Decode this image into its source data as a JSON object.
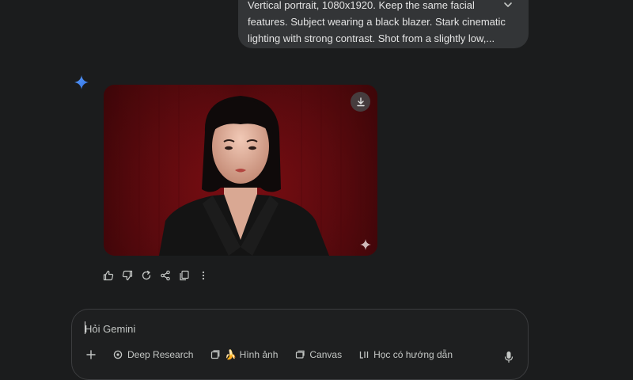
{
  "user_prompt": {
    "lines": [
      "Vertical portrait, 1080x1920. Keep the same facial",
      "features. Subject wearing a black blazer. Stark cinematic",
      "lighting with strong contrast. Shot from a slightly low,..."
    ],
    "expand_icon": "chevron-down-icon"
  },
  "response": {
    "logo_icon": "gemini-spark-icon",
    "image": {
      "description_icon": "generated-portrait-image",
      "download_icon": "download-icon",
      "watermark_icon": "sparkle-watermark-icon",
      "background_color": "#6b0b10"
    },
    "actions": [
      {
        "name": "thumbs-up-icon"
      },
      {
        "name": "thumbs-down-icon"
      },
      {
        "name": "regenerate-icon"
      },
      {
        "name": "share-icon"
      },
      {
        "name": "copy-icon"
      },
      {
        "name": "more-options-icon"
      }
    ]
  },
  "composer": {
    "placeholder": "Hỏi Gemini",
    "tools": [
      {
        "label": "",
        "icon": "plus-icon"
      },
      {
        "label": "Deep Research",
        "icon": "deep-research-icon"
      },
      {
        "label": "🍌 Hình ảnh",
        "icon": "image-icon"
      },
      {
        "label": "Canvas",
        "icon": "canvas-icon"
      },
      {
        "label": "Học có hướng dẫn",
        "icon": "guided-learning-icon"
      }
    ],
    "mic_icon": "microphone-icon"
  },
  "colors": {
    "background": "#1b1c1d",
    "bubble": "#333537",
    "text": "#e3e3e3",
    "gemini_blue": "#4c8df6"
  }
}
